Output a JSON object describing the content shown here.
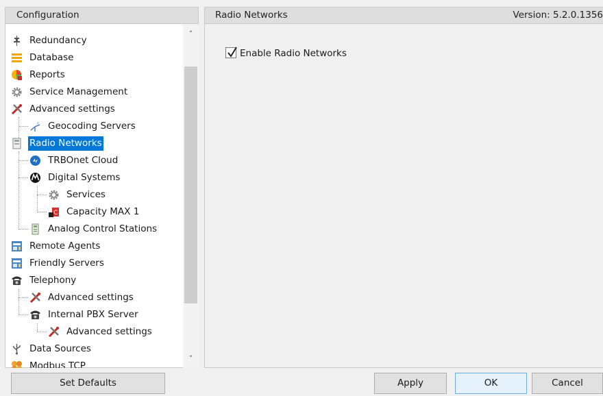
{
  "left_panel": {
    "header": "Configuration",
    "tree": [
      {
        "label": "Redundancy",
        "icon": "redundancy-icon"
      },
      {
        "label": "Database",
        "icon": "database-icon"
      },
      {
        "label": "Reports",
        "icon": "reports-icon"
      },
      {
        "label": "Service Management",
        "icon": "gear-icon"
      },
      {
        "label": "Advanced settings",
        "icon": "tools-icon"
      },
      {
        "label": "Geocoding Servers",
        "icon": "geocoding-icon"
      },
      {
        "label": "Radio Networks",
        "icon": "radio-network-icon",
        "selected": true
      },
      {
        "label": "TRBOnet Cloud",
        "icon": "cloud-icon"
      },
      {
        "label": "Digital Systems",
        "icon": "motorola-icon"
      },
      {
        "label": "Services",
        "icon": "gear-icon"
      },
      {
        "label": "Capacity MAX 1",
        "icon": "capacity-max-icon"
      },
      {
        "label": "Analog Control Stations",
        "icon": "analog-station-icon"
      },
      {
        "label": "Remote Agents",
        "icon": "server-icon"
      },
      {
        "label": "Friendly Servers",
        "icon": "server-icon"
      },
      {
        "label": "Telephony",
        "icon": "telephone-icon"
      },
      {
        "label": "Advanced settings",
        "icon": "tools-icon"
      },
      {
        "label": "Internal PBX Server",
        "icon": "telephone-icon"
      },
      {
        "label": "Advanced settings",
        "icon": "tools-icon"
      },
      {
        "label": "Data Sources",
        "icon": "usb-icon"
      },
      {
        "label": "Modbus TCP",
        "icon": "modbus-icon"
      }
    ]
  },
  "right_panel": {
    "header": "Radio Networks",
    "version": "Version: 5.2.0.1356",
    "enable_checkbox": {
      "label": "Enable Radio Networks",
      "checked": true
    }
  },
  "buttons": {
    "set_defaults": "Set Defaults",
    "apply": "Apply",
    "ok": "OK",
    "cancel": "Cancel"
  },
  "colors": {
    "selection": "#0078d7",
    "header_bg": "#dedede",
    "window_bg": "#f0f0f0"
  }
}
